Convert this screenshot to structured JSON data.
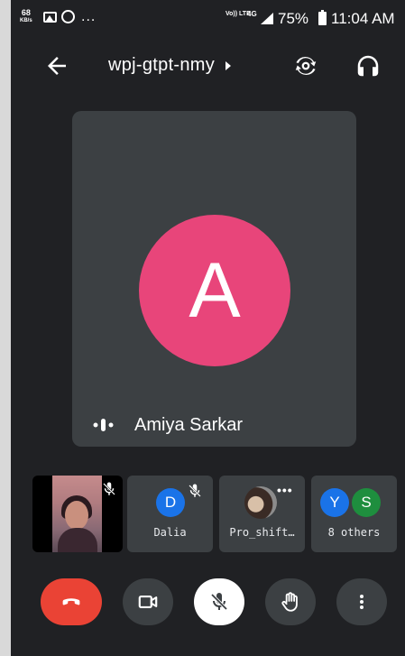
{
  "status_bar": {
    "net_speed": "68",
    "net_unit": "KB/s",
    "more": "...",
    "volte": "Vo)) LTE",
    "network": "4G",
    "battery": "75%",
    "time": "11:04 AM"
  },
  "header": {
    "meeting_code": "wpj-gtpt-nmy"
  },
  "main_tile": {
    "avatar_letter": "A",
    "avatar_color": "#e8457a",
    "speaker_name": "Amiya Sarkar"
  },
  "participants": [
    {
      "avatar_letter": "D",
      "name": "Dalia",
      "muted": true,
      "color": "#1a73e8"
    },
    {
      "name": "Pro_shift…",
      "more": "•••"
    },
    {
      "avatars": [
        "Y",
        "S"
      ],
      "name": "8 others",
      "colors": [
        "#1a73e8",
        "#1e8e3e"
      ]
    }
  ],
  "controls": {
    "end_color": "#ea4335",
    "mic_state": "muted"
  },
  "icons": [
    "back-arrow-icon",
    "caret-right-icon",
    "switch-camera-icon",
    "headphones-icon",
    "mic-off-icon",
    "speaking-icon",
    "end-call-icon",
    "video-icon",
    "hand-raise-icon",
    "more-vert-icon"
  ]
}
